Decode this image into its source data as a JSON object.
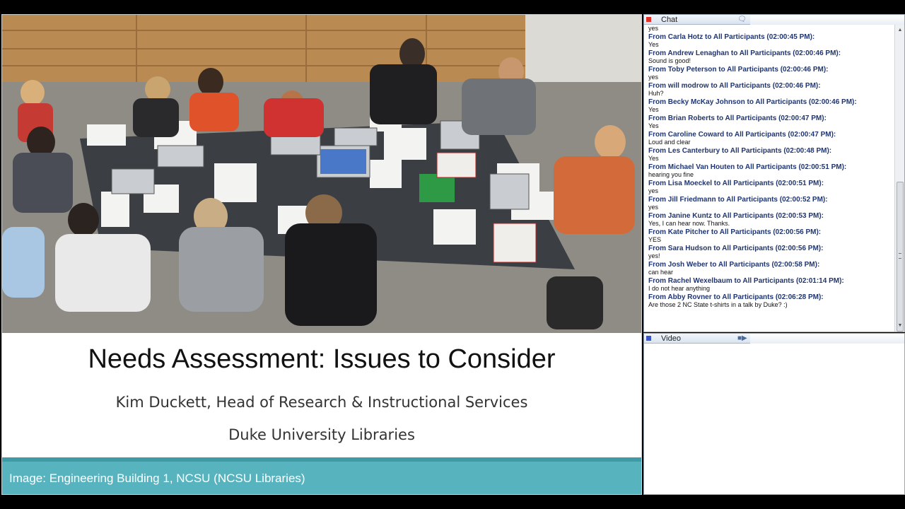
{
  "slide": {
    "title": "Needs Assessment: Issues to Consider",
    "presenter": "Kim Duckett, Head of Research & Instructional  Services",
    "organization": "Duke University Libraries",
    "caption": "Image: Engineering Building 1, NCSU (NCSU Libraries)"
  },
  "chat": {
    "title": "Chat",
    "icon": "speech-bubble-icon",
    "led_color": "#e0302a",
    "messages": [
      {
        "text": "yes"
      },
      {
        "from": "From Carla Hotz to All Participants (02:00:45 PM):",
        "text": "Yes"
      },
      {
        "from": "From Andrew Lenaghan to All Participants (02:00:46 PM):",
        "text": "Sound is good!"
      },
      {
        "from": "From Toby Peterson to All Participants (02:00:46 PM):",
        "text": "yes"
      },
      {
        "from": "From will modrow to All Participants (02:00:46 PM):",
        "text": "Huh?"
      },
      {
        "from": "From Becky McKay Johnson to All Participants (02:00:46 PM):",
        "text": "Yes"
      },
      {
        "from": "From Brian Roberts to All Participants (02:00:47 PM):",
        "text": "Yes"
      },
      {
        "from": "From Caroline Coward to All Participants (02:00:47 PM):",
        "text": "Loud and clear"
      },
      {
        "from": "From Les Canterbury to All Participants (02:00:48 PM):",
        "text": "Yes"
      },
      {
        "from": "From Michael Van Houten to All Participants (02:00:51 PM):",
        "text": "hearing you fine"
      },
      {
        "from": "From Lisa Moeckel to All Participants (02:00:51 PM):",
        "text": "yes"
      },
      {
        "from": "From Jill Friedmann to All Participants (02:00:52 PM):",
        "text": "yes"
      },
      {
        "from": "From Janine Kuntz to All Participants (02:00:53 PM):",
        "text": "Yes, I can hear now. Thanks."
      },
      {
        "from": "From Kate Pitcher to All Participants (02:00:56 PM):",
        "text": "YES"
      },
      {
        "from": "From Sara Hudson to All Participants (02:00:56 PM):",
        "text": "yes!"
      },
      {
        "from": "From Josh Weber to All Participants (02:00:58 PM):",
        "text": "can hear"
      },
      {
        "from": "From Rachel Wexelbaum to All Participants (02:01:14 PM):",
        "text": "I do not hear anything"
      },
      {
        "from": "From Abby Rovner to All Participants (02:06:28 PM):",
        "text": "Are those 2 NC State t-shirts in a talk by Duke? :)"
      }
    ]
  },
  "video": {
    "title": "Video",
    "icon": "camera-icon",
    "led_color": "#3a55c8"
  },
  "colors": {
    "caption_bar": "#57b3bd",
    "chat_name": "#1f3570"
  }
}
